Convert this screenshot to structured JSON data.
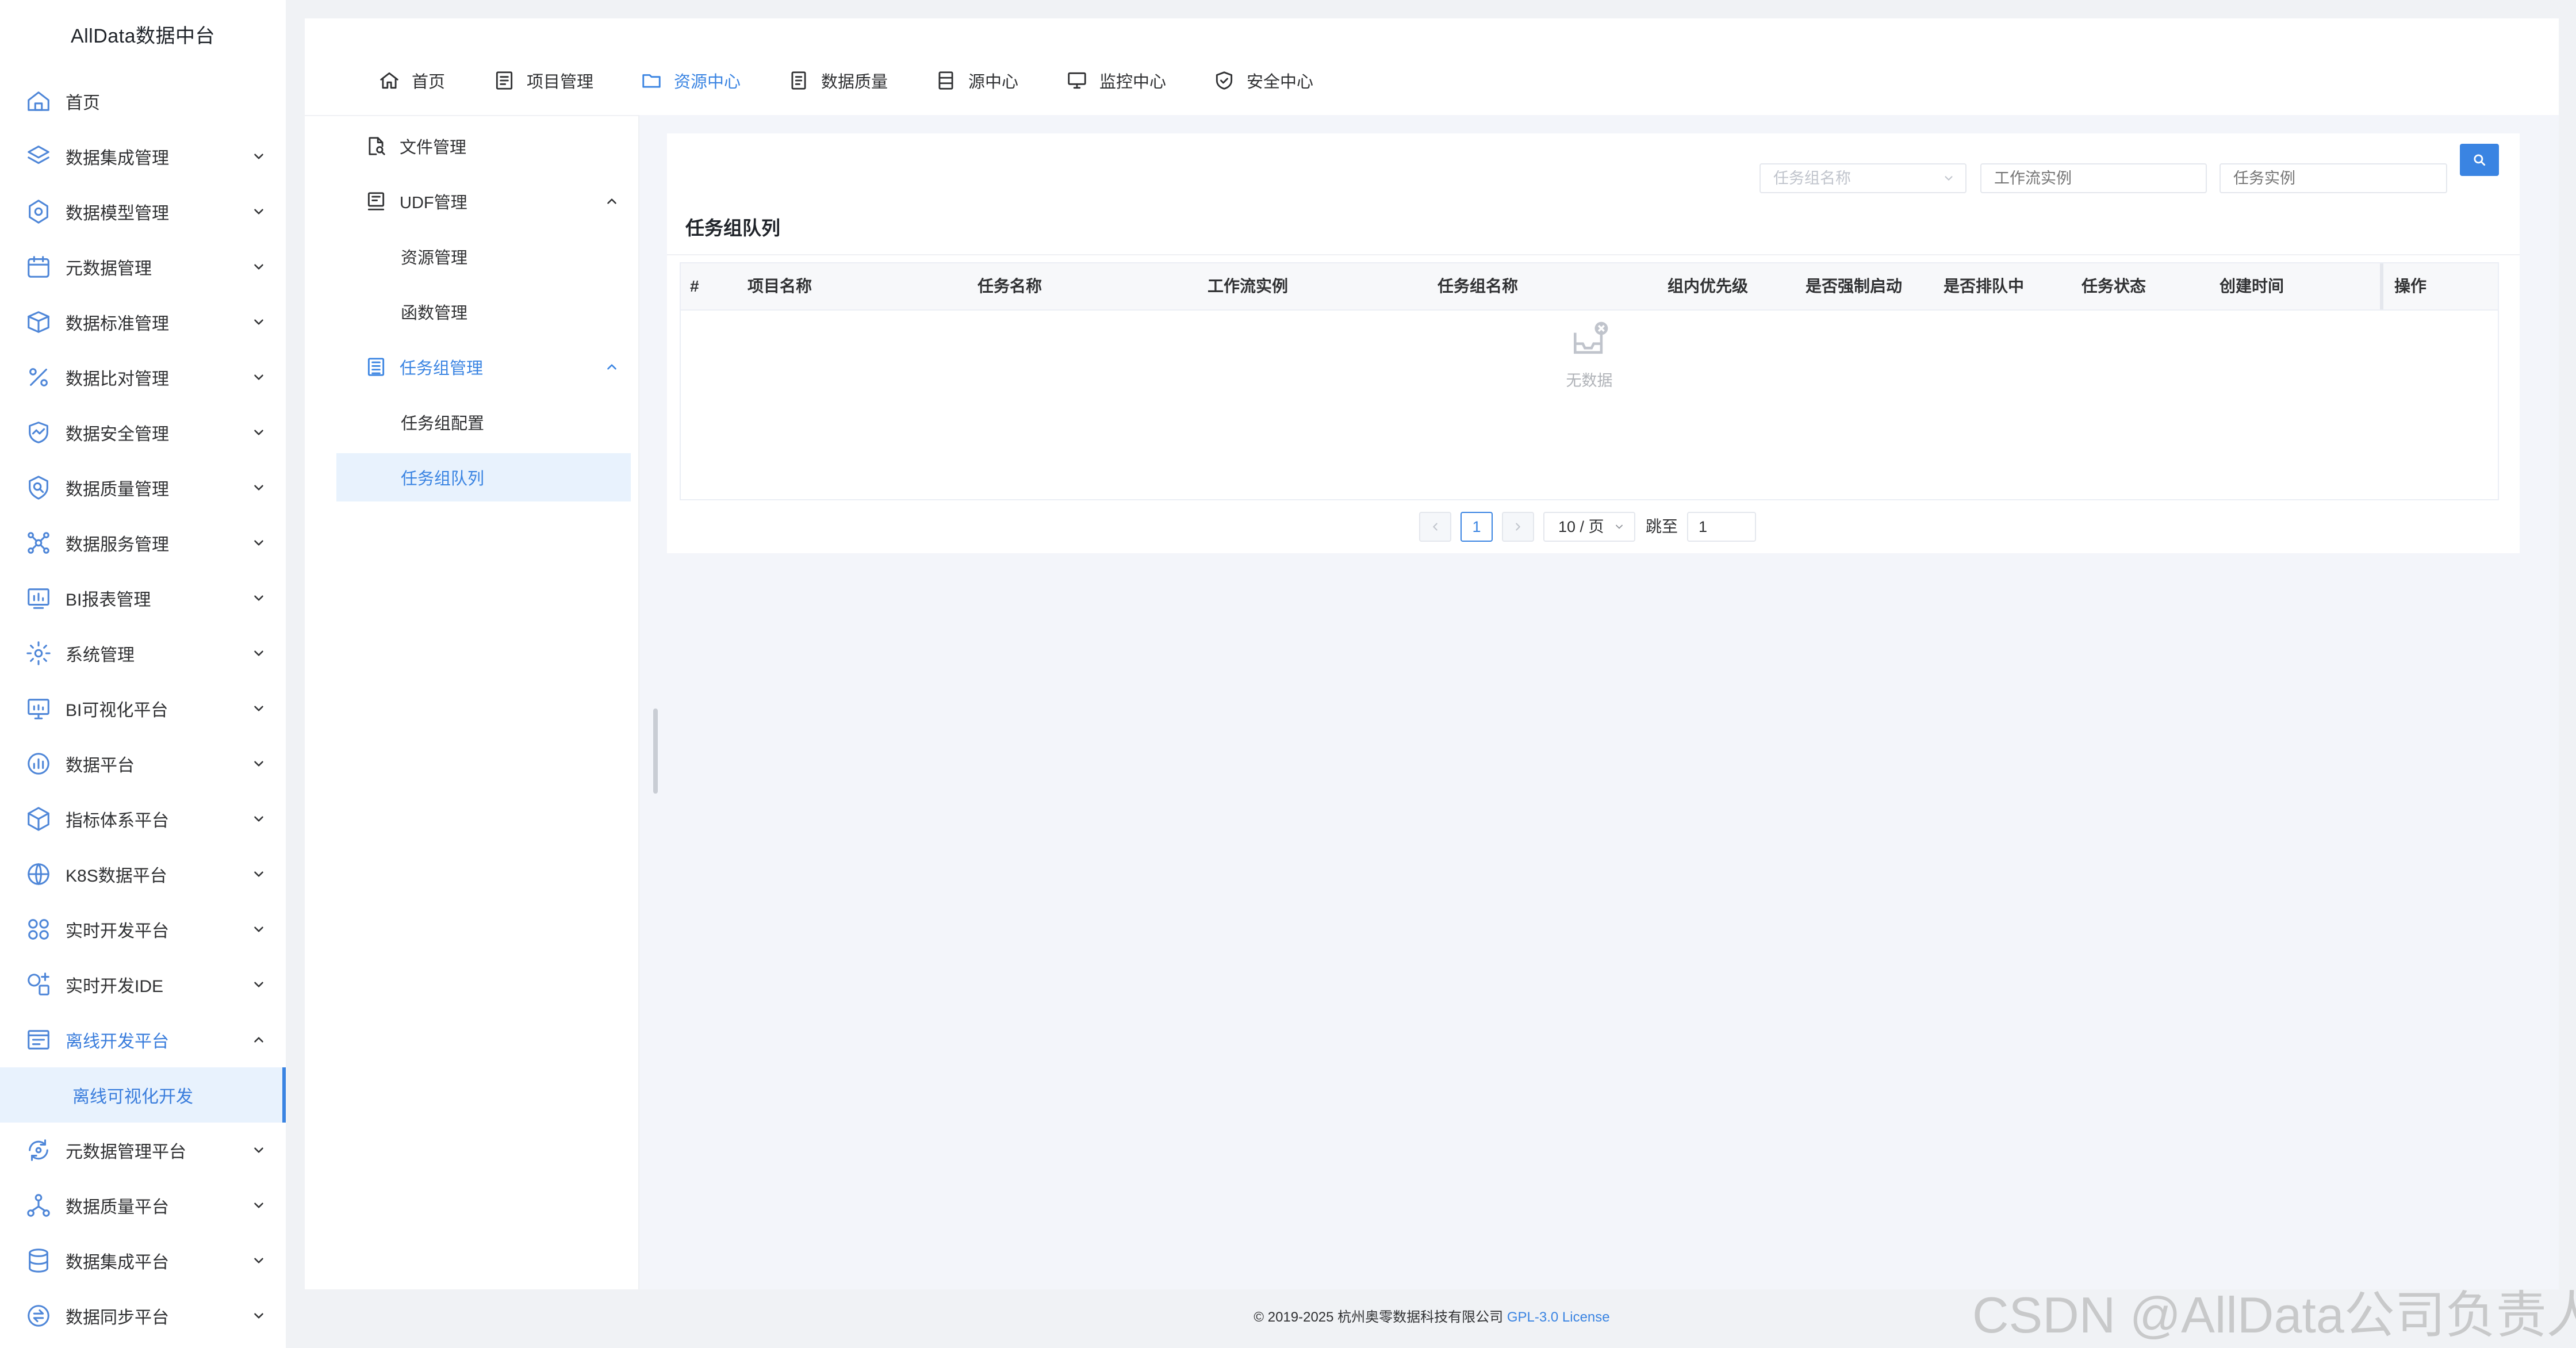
{
  "app": {
    "logo_text": "AllData数据中台"
  },
  "sidebar": {
    "items": [
      {
        "label": "首页",
        "icon": "home-icon"
      },
      {
        "label": "数据集成管理",
        "icon": "layers-icon"
      },
      {
        "label": "数据模型管理",
        "icon": "model-icon"
      },
      {
        "label": "元数据管理",
        "icon": "calendar-icon"
      },
      {
        "label": "数据标准管理",
        "icon": "box-icon"
      },
      {
        "label": "数据比对管理",
        "icon": "percent-icon"
      },
      {
        "label": "数据安全管理",
        "icon": "shield-chart-icon"
      },
      {
        "label": "数据质量管理",
        "icon": "search-badge-icon"
      },
      {
        "label": "数据服务管理",
        "icon": "network-icon"
      },
      {
        "label": "BI报表管理",
        "icon": "report-icon"
      },
      {
        "label": "系统管理",
        "icon": "gear-icon"
      },
      {
        "label": "BI可视化平台",
        "icon": "monitor-icon"
      },
      {
        "label": "数据平台",
        "icon": "bar-chart-icon"
      },
      {
        "label": "指标体系平台",
        "icon": "cube-icon"
      },
      {
        "label": "K8S数据平台",
        "icon": "globe-icon"
      },
      {
        "label": "实时开发平台",
        "icon": "grid-circles-icon"
      },
      {
        "label": "实时开发IDE",
        "icon": "ide-icon"
      },
      {
        "label": "离线开发平台",
        "icon": "browser-icon"
      },
      {
        "label": "离线可视化开发",
        "icon": ""
      },
      {
        "label": "元数据管理平台",
        "icon": "refresh-icon"
      },
      {
        "label": "数据质量平台",
        "icon": "nodes-icon"
      },
      {
        "label": "数据集成平台",
        "icon": "database-icon"
      },
      {
        "label": "数据同步平台",
        "icon": "sync-icon"
      }
    ]
  },
  "topnav": {
    "tabs": [
      {
        "label": "首页",
        "icon": "home-icon"
      },
      {
        "label": "项目管理",
        "icon": "list-icon"
      },
      {
        "label": "资源中心",
        "icon": "folder-icon"
      },
      {
        "label": "数据质量",
        "icon": "document-icon"
      },
      {
        "label": "源中心",
        "icon": "server-icon"
      },
      {
        "label": "监控中心",
        "icon": "monitor-icon"
      },
      {
        "label": "安全中心",
        "icon": "shield-check-icon"
      }
    ]
  },
  "inner_menu": {
    "items": [
      {
        "label": "文件管理"
      },
      {
        "label": "UDF管理"
      },
      {
        "label": "资源管理"
      },
      {
        "label": "函数管理"
      },
      {
        "label": "任务组管理"
      },
      {
        "label": "任务组配置"
      },
      {
        "label": "任务组队列"
      }
    ]
  },
  "search": {
    "group_placeholder": "任务组名称",
    "workflow_placeholder": "工作流实例",
    "task_placeholder": "任务实例"
  },
  "list": {
    "title": "任务组队列",
    "columns": [
      "#",
      "项目名称",
      "任务名称",
      "工作流实例",
      "任务组名称",
      "组内优先级",
      "是否强制启动",
      "是否排队中",
      "任务状态",
      "创建时间",
      "操作"
    ],
    "empty_text": "无数据"
  },
  "pagination": {
    "current_page": "1",
    "page_size": "10 / 页",
    "jump_label": "跳至",
    "jump_value": "1"
  },
  "footer": {
    "copyright": "© 2019-2025 杭州奥零数据科技有限公司 ",
    "license": "GPL-3.0 License"
  },
  "watermark": "CSDN @AllData公司负责人",
  "colors": {
    "accent": "#3a84e2",
    "active_bg": "#e8f2fd",
    "page_bg": "#f0f2f5"
  }
}
